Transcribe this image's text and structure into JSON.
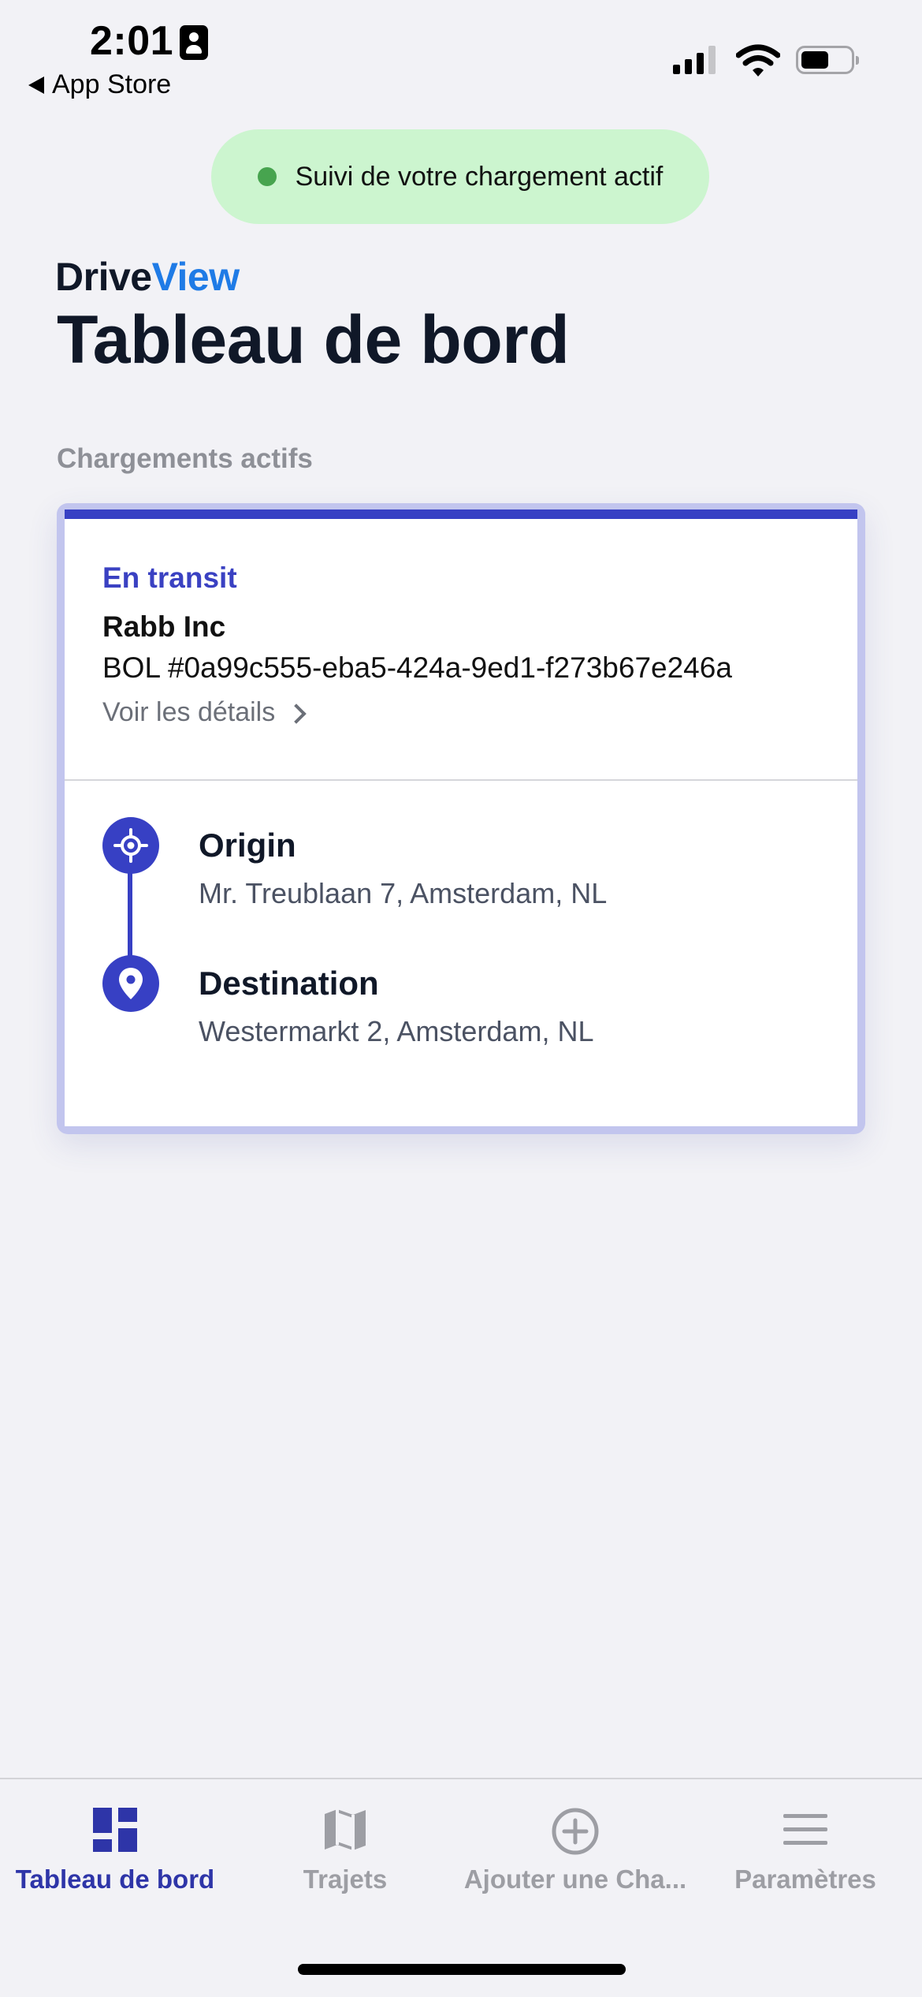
{
  "status_bar": {
    "time": "2:01",
    "back_label": "App Store"
  },
  "tracking_pill": {
    "text": "Suivi de votre chargement actif",
    "dot_color": "#47a44f"
  },
  "header": {
    "brand_part1": "Drive",
    "brand_part2": "View",
    "brand_accent_color": "#1f7be6",
    "title": "Tableau de bord"
  },
  "active_loads": {
    "section_label": "Chargements actifs",
    "cards": [
      {
        "status": "En transit",
        "customer": "Rabb Inc",
        "bol": "BOL #0a99c555-eba5-424a-9ed1-f273b67e246a",
        "details_link": "Voir les détails",
        "origin_label": "Origin",
        "origin_address": "Mr. Treublaan 7, Amsterdam, NL",
        "destination_label": "Destination",
        "destination_address": "Westermarkt 2, Amsterdam, NL",
        "accent_color": "#3740c4"
      }
    ]
  },
  "tab_bar": {
    "active_color": "#2e35a8",
    "inactive_color": "#9d9ea4",
    "tabs": [
      {
        "label": "Tableau de bord",
        "icon": "dashboard-icon",
        "active": true
      },
      {
        "label": "Trajets",
        "icon": "map-icon",
        "active": false
      },
      {
        "label": "Ajouter une Cha...",
        "icon": "add-circle-icon",
        "active": false
      },
      {
        "label": "Paramètres",
        "icon": "menu-icon",
        "active": false
      }
    ]
  }
}
